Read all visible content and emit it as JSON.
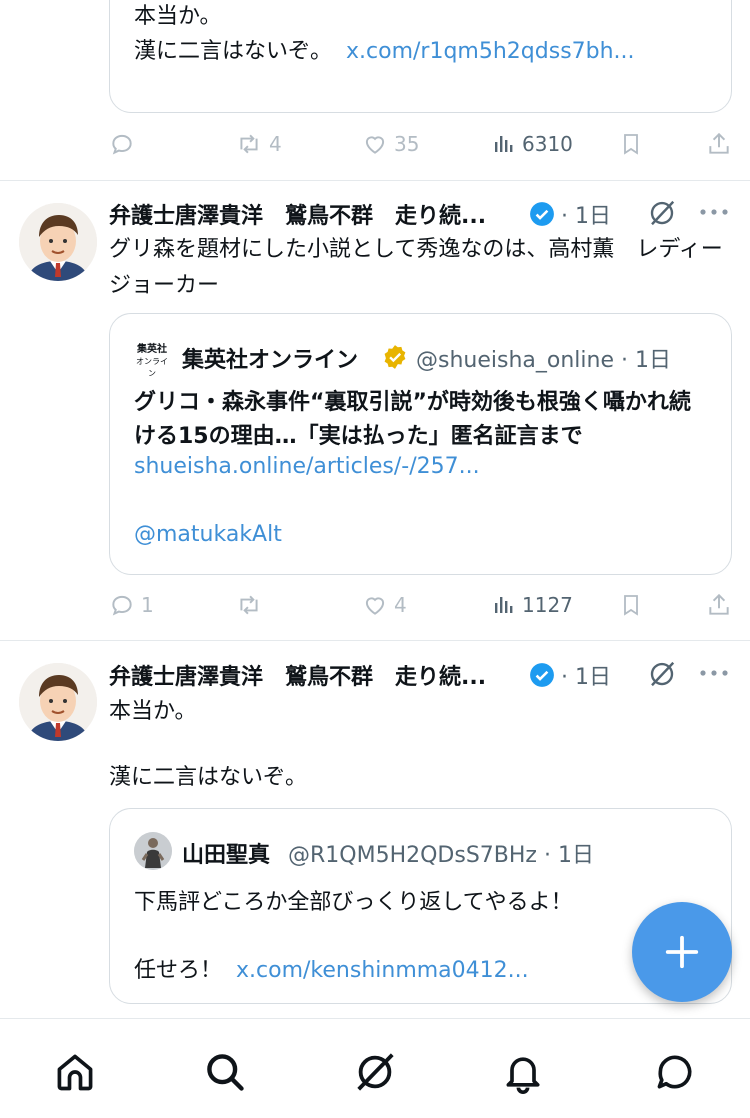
{
  "post1": {
    "quote": {
      "line1": "本当か。",
      "line2_text": "漢に二言はないぞ。",
      "line2_link": "x.com/r1qm5h2qdss7bh..."
    },
    "actions": {
      "retweets": "4",
      "likes": "35",
      "views": "6310"
    }
  },
  "post2": {
    "author": "弁護士唐澤貴洋　鷲鳥不群　走り続...",
    "time": "· 1日",
    "text": "グリ森を題材にした小説として秀逸なのは、高村薫　レディージョーカー",
    "quote": {
      "logo_text": "集英社オンライン",
      "name": "集英社オンライン",
      "handle": "@shueisha_online · 1日",
      "body": "グリコ・森永事件“裏取引説”が時効後も根強く囁かれ続ける15の理由…「実は払った」匿名証言まで",
      "link": "shueisha.online/articles/-/257...",
      "mention": "@matukakAlt"
    },
    "actions": {
      "replies": "1",
      "retweets": "",
      "likes": "4",
      "views": "1127"
    }
  },
  "post3": {
    "author": "弁護士唐澤貴洋　鷲鳥不群　走り続...",
    "time": "· 1日",
    "text_line1": "本当か。",
    "text_line2": "漢に二言はないぞ。",
    "quote": {
      "name": "山田聖真",
      "handle": "@R1QM5H2QDsS7BHz · 1日",
      "line1": "下馬評どころか全部びっくり返してやるよ！",
      "line2_text": "任せろ！",
      "line2_link": "x.com/kenshinmma0412..."
    }
  },
  "nav": [
    "home-icon",
    "search-icon",
    "grok-icon",
    "notifications-icon",
    "messages-icon"
  ],
  "colors": {
    "accent": "#4a99e9",
    "link": "#3f8fd6",
    "gray": "#8b98a5",
    "verified": "#1d9bf0",
    "gold": "#e8b400"
  }
}
